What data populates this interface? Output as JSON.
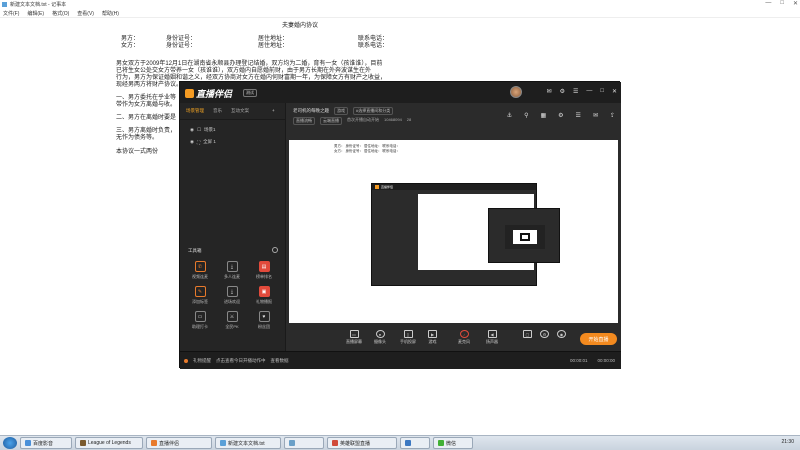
{
  "notepad": {
    "title": "新建文本文档.txt - 记事本",
    "menu": [
      "文件(F)",
      "编辑(E)",
      "格式(O)",
      "查看(V)",
      "帮助(H)"
    ],
    "window_controls": [
      "—",
      "□",
      "✕"
    ],
    "doc_title": "夫妻婚内协议",
    "row1": {
      "a": "男方：",
      "b": "身份证号：",
      "c": "居住地址：",
      "d": "联系电话："
    },
    "row2": {
      "a": "女方：",
      "b": "身份证号：",
      "c": "居住地址：",
      "d": "联系电话："
    },
    "para1": "男女双方于2009年12月1日在湖南省永顺县办理登记结婚，双方均为二婚，育有一女（孩谁谁），目前",
    "para2": "已将生女公处交女方带养一女（孩谁谁），双方婚内自愿婚前财，由于男方长期在外奔波谋生在外",
    "para3": "行为，男方为保证婚姻和谐之义，经双方协商对女方在婚内何财富期一年，为保障女方有财产之收益，",
    "para4": "现经男两方将财产协议。",
    "item1": "一、男方委托在乎业等",
    "item1b": "带作为女方离婚与收。",
    "item2": "二、男方在离婚时要是",
    "item3": "三、男方离婚时负责，",
    "item3b": "无作为债务等。",
    "ending": "本协议一式两份"
  },
  "app": {
    "logo": "直播伴侣",
    "version": "测试",
    "header_icons": [
      "✉",
      "⚙",
      "☰",
      "—",
      "□",
      "✕"
    ],
    "tabs": [
      "场景管理",
      "音乐",
      "互动文案"
    ],
    "add_scene": "+",
    "scenes": [
      {
        "label": "场景1",
        "icon": "☐"
      },
      {
        "label": "全屏 1",
        "icon": "⛶"
      }
    ],
    "tools_title": "工具箱",
    "tools": [
      {
        "label": "视频连麦",
        "icon": "✆",
        "style": "orange"
      },
      {
        "label": "多人连麦",
        "icon": "⤓",
        "style": ""
      },
      {
        "label": "榜单排名",
        "icon": "▤",
        "style": "red"
      },
      {
        "label": "添加标签",
        "icon": "✎",
        "style": "orange"
      },
      {
        "label": "进场欢迎",
        "icon": "⤓",
        "style": ""
      },
      {
        "label": "礼物播报",
        "icon": "▣",
        "style": "red"
      },
      {
        "label": "助理打卡",
        "icon": "▭",
        "style": ""
      },
      {
        "label": "全民PK",
        "icon": "⚔",
        "style": ""
      },
      {
        "label": "粉丝团",
        "icon": "♥",
        "style": ""
      }
    ],
    "room": {
      "title": "老司机的每晚之趣",
      "chip1": "游戏",
      "chip2": "#选择直播间和分类",
      "meta1": "直播流畅",
      "meta2": "云端直播",
      "meta3": "首次开播自动开始",
      "meta4": "10468094",
      "meta5": "28"
    },
    "room_icons": [
      "⚓",
      "⚲",
      "▦",
      "⚙",
      "☰",
      "✉",
      "⇪"
    ],
    "preview_lines": [
      "男方：  身份证号：  居住地址：  联系电话：",
      "女方：  身份证号：  居住地址：  联系电话："
    ],
    "controls": [
      {
        "label": "直播屏幕",
        "icon": "▭"
      },
      {
        "label": "摄像头",
        "icon": "●"
      },
      {
        "label": "手机投屏",
        "icon": "▯"
      },
      {
        "label": "游戏",
        "icon": "▶"
      },
      {
        "label": "麦克风",
        "icon": "♪",
        "style": "red"
      },
      {
        "label": "扬声器",
        "icon": "◀",
        "style": ""
      },
      {
        "label": "",
        "icon": "▢"
      },
      {
        "label": "",
        "icon": "⚙"
      },
      {
        "label": "",
        "icon": "◉"
      }
    ],
    "live_button": "开始直播",
    "footer_text1": "礼物提醒",
    "footer_text2": "点击查看今日开播动作中",
    "footer_text3": "查看数据",
    "footer_time1": "00:00:01",
    "footer_time2": "00:00:00"
  },
  "taskbar": {
    "items": [
      {
        "label": "百度影音",
        "color": "#4a90d9"
      },
      {
        "label": "League of Legends",
        "color": "#7a5a2e"
      },
      {
        "label": "直播伴侣",
        "color": "#e87a2c"
      },
      {
        "label": "新建文本文档.txt",
        "color": "#5aa0d8"
      },
      {
        "label": "",
        "color": "#6aa0c8"
      },
      {
        "label": "英雄联盟直播",
        "color": "#d04a3a"
      },
      {
        "label": "",
        "color": "#3b78c2"
      },
      {
        "label": "微信",
        "color": "#41b035"
      }
    ],
    "clock": "21:30"
  }
}
